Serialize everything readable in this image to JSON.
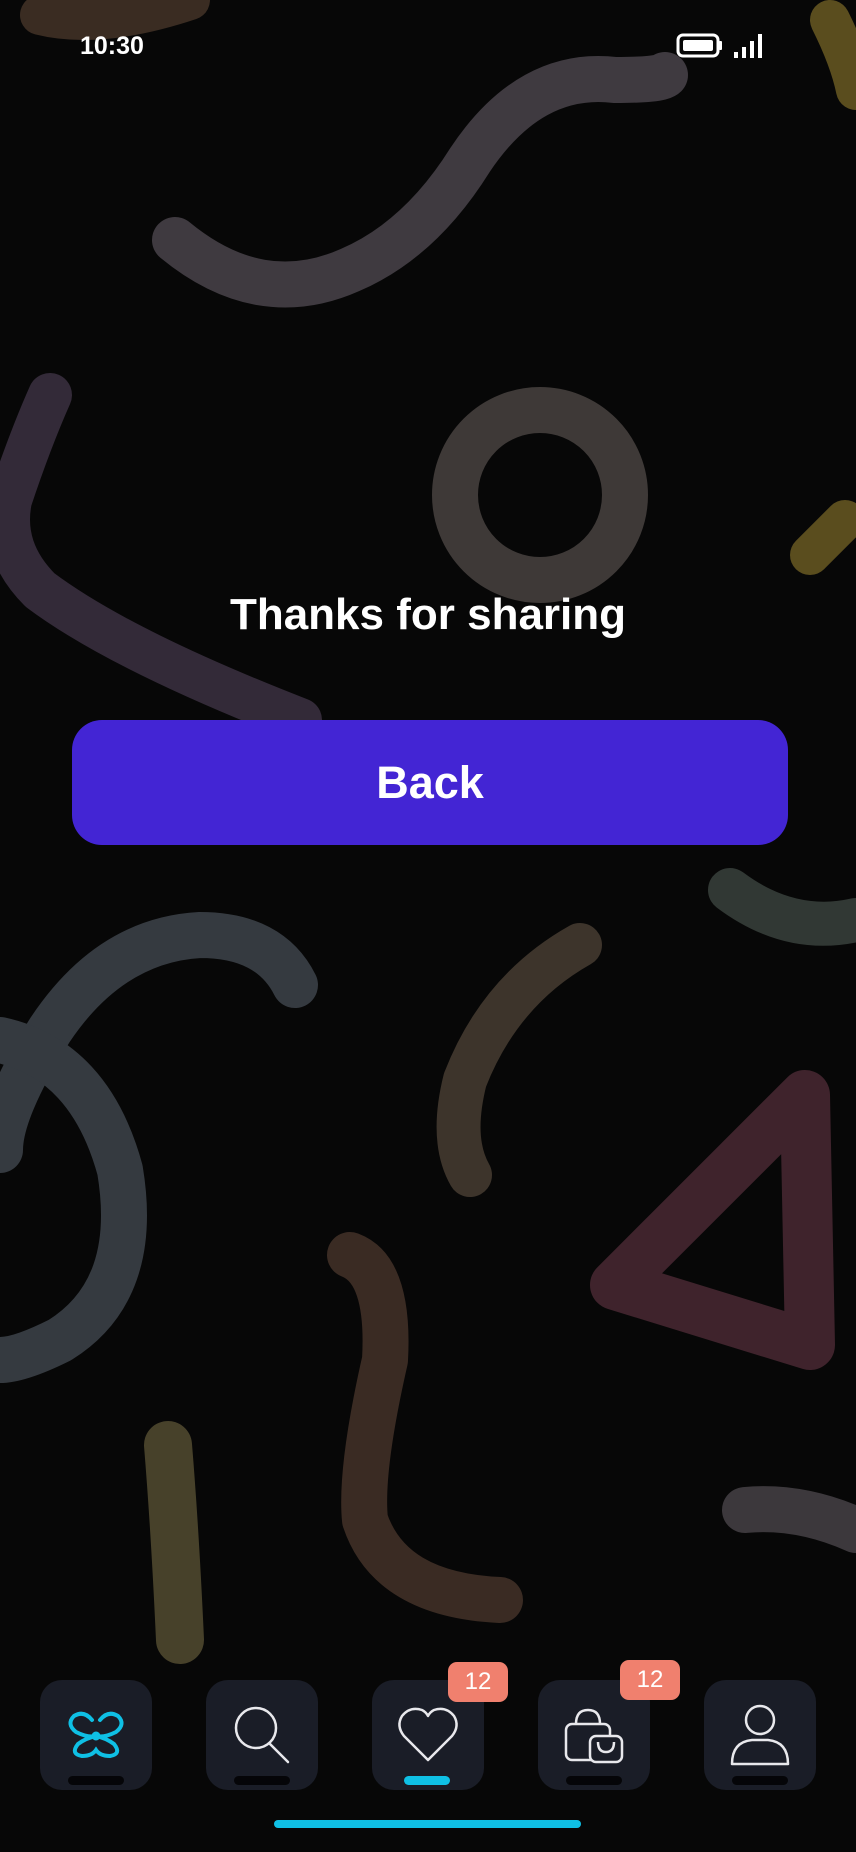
{
  "status_bar": {
    "time": "10:30"
  },
  "main": {
    "message": "Thanks for sharing",
    "back_label": "Back"
  },
  "tab_bar": {
    "active_tab": "favorites",
    "tabs": [
      {
        "name": "home",
        "icon": "logo-icon"
      },
      {
        "name": "search",
        "icon": "search-icon"
      },
      {
        "name": "favorites",
        "icon": "heart-icon",
        "badge": "12"
      },
      {
        "name": "bag",
        "icon": "shopping-bag-icon",
        "badge": "12"
      },
      {
        "name": "profile",
        "icon": "user-icon"
      }
    ]
  },
  "colors": {
    "background": "#070707",
    "primary_button": "#4325d4",
    "accent": "#0fc0e5",
    "badge": "#f0806e",
    "tab_background": "#1a1d27"
  }
}
